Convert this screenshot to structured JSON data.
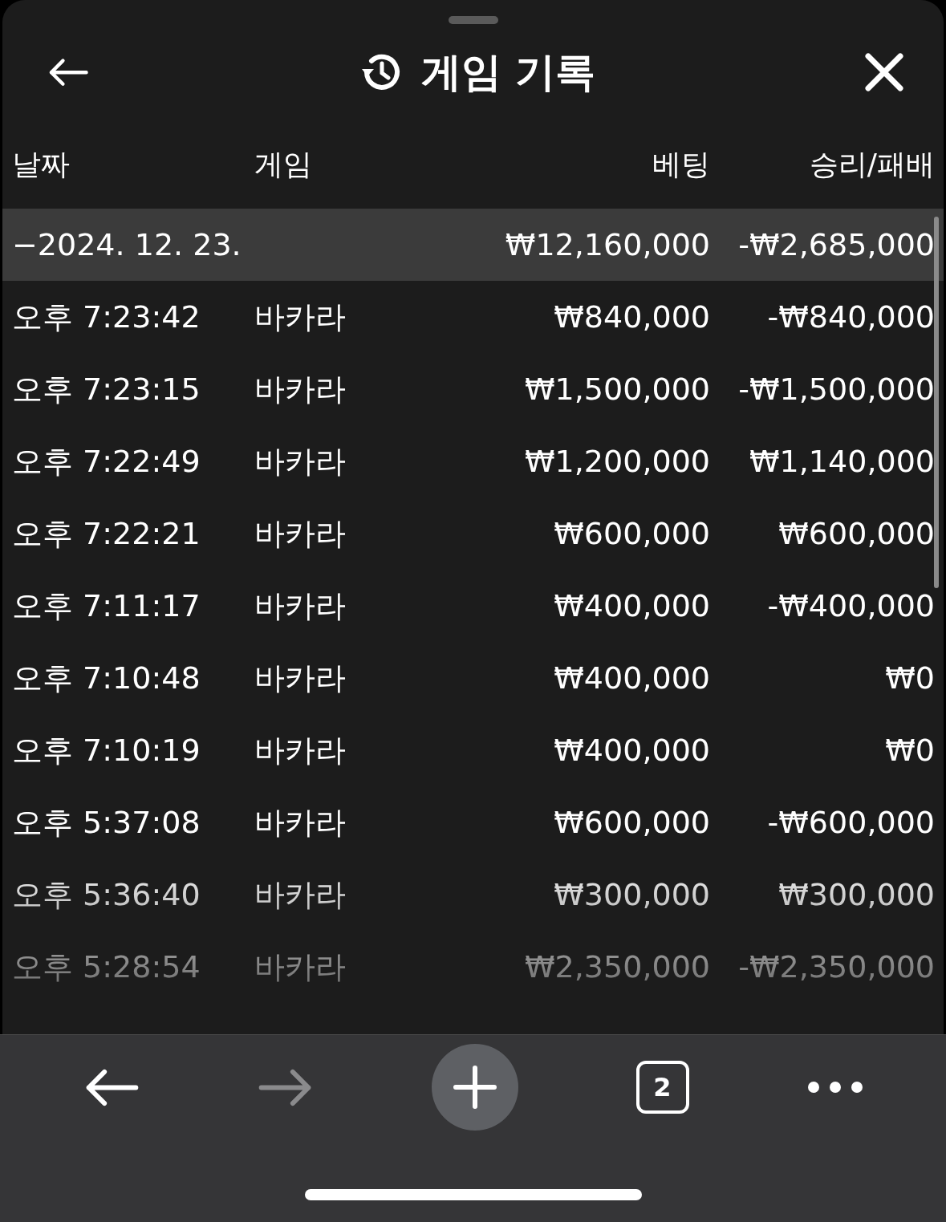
{
  "header": {
    "title": "게임 기록"
  },
  "table": {
    "columns": [
      "날짜",
      "게임",
      "베팅",
      "승리/패배"
    ],
    "group": {
      "label": "−2024. 12. 23.",
      "bet": "₩12,160,000",
      "result": "-₩2,685,000",
      "expanded": true
    },
    "rows": [
      {
        "time": "오후 7:23:42",
        "game": "바카라",
        "bet": "₩840,000",
        "result": "-₩840,000"
      },
      {
        "time": "오후 7:23:15",
        "game": "바카라",
        "bet": "₩1,500,000",
        "result": "-₩1,500,000"
      },
      {
        "time": "오후 7:22:49",
        "game": "바카라",
        "bet": "₩1,200,000",
        "result": "₩1,140,000"
      },
      {
        "time": "오후 7:22:21",
        "game": "바카라",
        "bet": "₩600,000",
        "result": "₩600,000"
      },
      {
        "time": "오후 7:11:17",
        "game": "바카라",
        "bet": "₩400,000",
        "result": "-₩400,000"
      },
      {
        "time": "오후 7:10:48",
        "game": "바카라",
        "bet": "₩400,000",
        "result": "₩0"
      },
      {
        "time": "오후 7:10:19",
        "game": "바카라",
        "bet": "₩400,000",
        "result": "₩0"
      },
      {
        "time": "오후 5:37:08",
        "game": "바카라",
        "bet": "₩600,000",
        "result": "-₩600,000"
      },
      {
        "time": "오후 5:36:40",
        "game": "바카라",
        "bet": "₩300,000",
        "result": "₩300,000"
      },
      {
        "time": "오후 5:28:54",
        "game": "바카라",
        "bet": "₩2,350,000",
        "result": "-₩2,350,000"
      }
    ]
  },
  "browser_toolbar": {
    "tab_count": "2",
    "forward_disabled": true
  }
}
